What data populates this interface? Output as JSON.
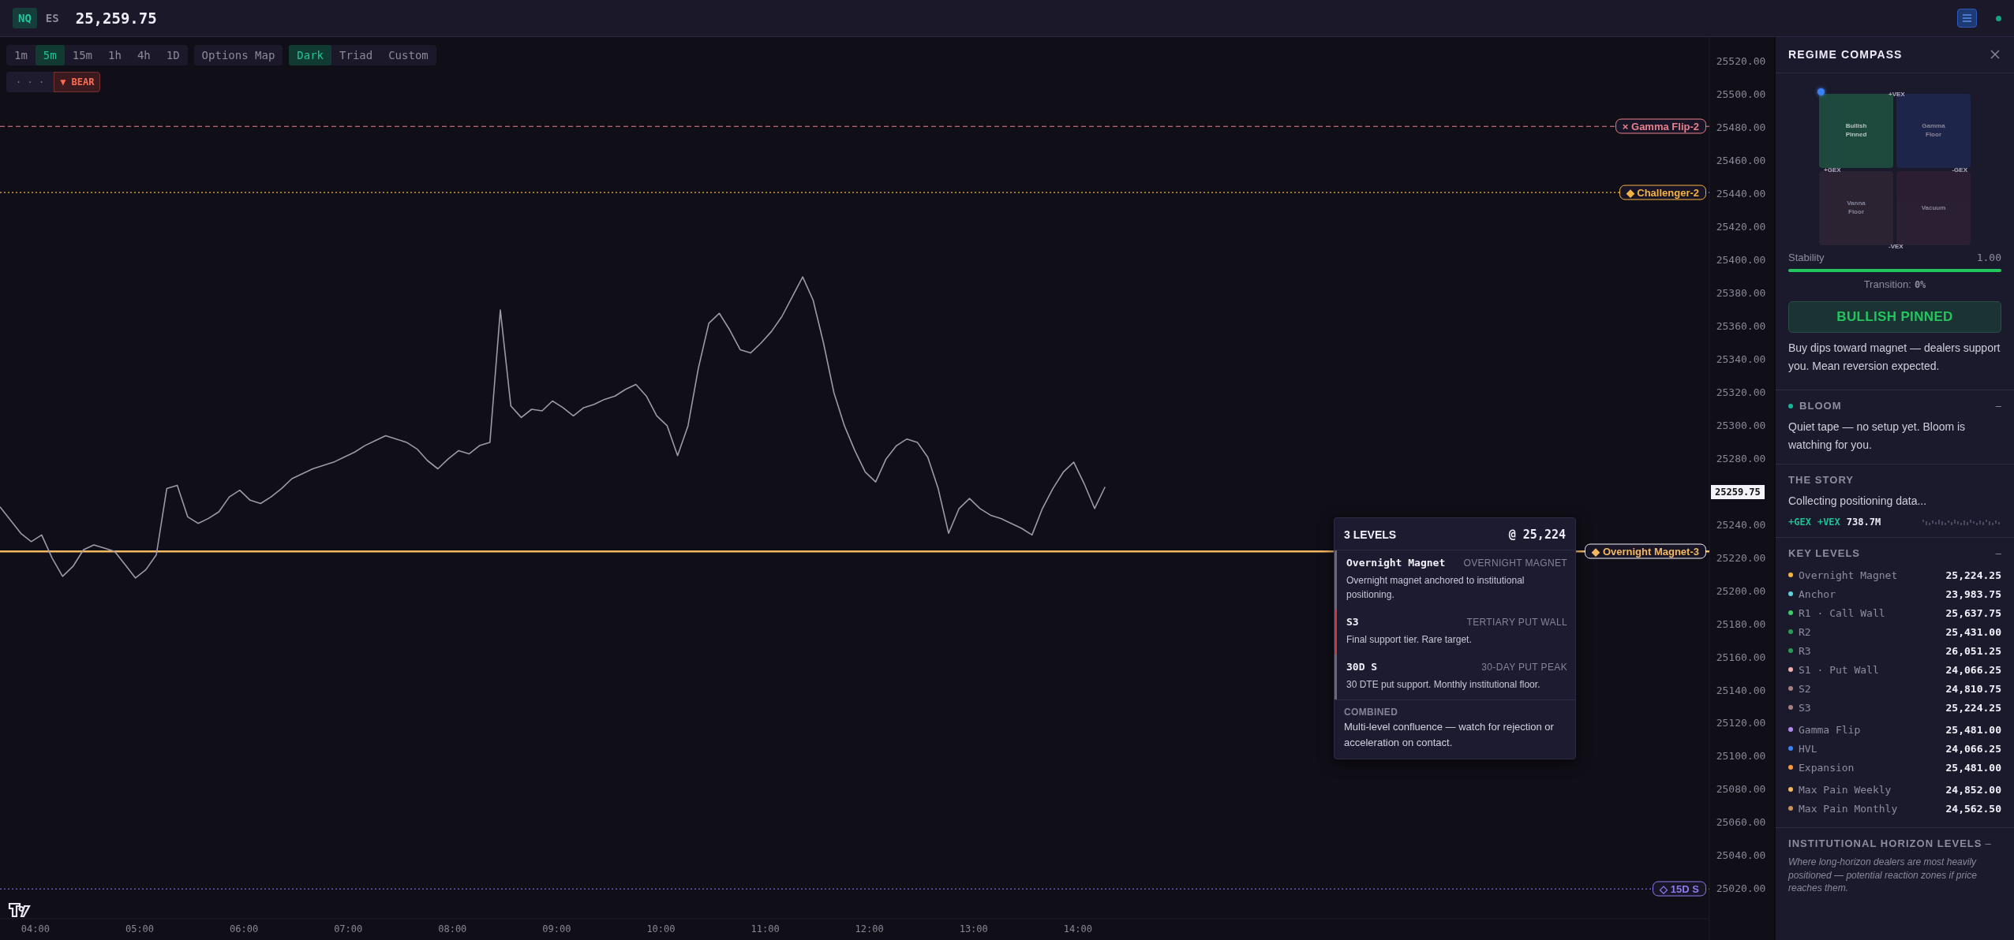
{
  "top_bar": {
    "symbols": [
      {
        "label": "NQ",
        "selected": true
      },
      {
        "label": "ES",
        "selected": false
      }
    ],
    "price": "25,259.75"
  },
  "toolbar": {
    "timeframes": [
      {
        "label": "1m",
        "selected": false
      },
      {
        "label": "5m",
        "selected": true
      },
      {
        "label": "15m",
        "selected": false
      },
      {
        "label": "1h",
        "selected": false
      },
      {
        "label": "4h",
        "selected": false
      },
      {
        "label": "1D",
        "selected": false
      }
    ],
    "options_button": "Options Map",
    "themes": [
      {
        "label": "Dark",
        "selected": true
      },
      {
        "label": "Triad",
        "selected": false
      },
      {
        "label": "Custom",
        "selected": false
      }
    ],
    "more_button": "· · ·",
    "bias": {
      "marker": "▼",
      "label": "BEAR"
    }
  },
  "chart": {
    "price_tag": "25259.75",
    "chart_data": {
      "type": "line",
      "x": [
        3.66,
        3.76,
        3.86,
        3.96,
        4.06,
        4.16,
        4.26,
        4.36,
        4.46,
        4.56,
        4.66,
        4.76,
        4.86,
        4.96,
        5.06,
        5.16,
        5.26,
        5.36,
        5.46,
        5.56,
        5.66,
        5.76,
        5.86,
        5.96,
        6.06,
        6.16,
        6.26,
        6.36,
        6.46,
        6.56,
        6.66,
        6.76,
        6.86,
        6.96,
        7.06,
        7.16,
        7.26,
        7.36,
        7.46,
        7.56,
        7.66,
        7.76,
        7.86,
        7.96,
        8.06,
        8.16,
        8.26,
        8.36,
        8.46,
        8.56,
        8.66,
        8.76,
        8.86,
        8.96,
        9.06,
        9.16,
        9.26,
        9.36,
        9.46,
        9.56,
        9.66,
        9.76,
        9.86,
        9.96,
        10.06,
        10.16,
        10.26,
        10.36,
        10.46,
        10.56,
        10.66,
        10.76,
        10.86,
        10.96,
        11.06,
        11.16,
        11.26,
        11.36,
        11.46,
        11.56,
        11.66,
        11.76,
        11.86,
        11.96,
        12.06,
        12.16,
        12.26,
        12.36,
        12.46,
        12.56,
        12.66,
        12.76,
        12.86,
        12.96,
        13.06,
        13.16,
        13.26,
        13.36,
        13.46,
        13.56,
        13.66,
        13.76,
        13.86,
        13.96,
        14.06,
        14.16,
        14.26
      ],
      "values": [
        25251,
        25243,
        25235,
        25230,
        25234,
        25220,
        25209,
        25215,
        25225,
        25228,
        25226,
        25224,
        25216,
        25208,
        25213,
        25222,
        25262,
        25264,
        25245,
        25241,
        25244,
        25248,
        25257,
        25261,
        25255,
        25253,
        25257,
        25262,
        25268,
        25271,
        25274,
        25276,
        25278,
        25281,
        25284,
        25288,
        25291,
        25294,
        25292,
        25290,
        25286,
        25279,
        25274,
        25280,
        25285,
        25283,
        25288,
        25290,
        25370,
        25312,
        25305,
        25310,
        25309,
        25315,
        25311,
        25306,
        25311,
        25313,
        25316,
        25318,
        25322,
        25325,
        25318,
        25306,
        25300,
        25282,
        25300,
        25335,
        25362,
        25368,
        25358,
        25346,
        25344,
        25350,
        25357,
        25366,
        25378,
        25390,
        25376,
        25350,
        25320,
        25300,
        25285,
        25272,
        25266,
        25280,
        25288,
        25292,
        25290,
        25281,
        25262,
        25235,
        25250,
        25256,
        25250,
        25246,
        25244,
        25241,
        25238,
        25234,
        25250,
        25262,
        25272,
        25278,
        25265,
        25250,
        25263
      ],
      "xlim": [
        3.66,
        20.05
      ],
      "ylim": [
        25002,
        25535
      ],
      "xticks": [
        {
          "value": 4,
          "label": "04:00"
        },
        {
          "value": 5,
          "label": "05:00"
        },
        {
          "value": 6,
          "label": "06:00"
        },
        {
          "value": 7,
          "label": "07:00"
        },
        {
          "value": 8,
          "label": "08:00"
        },
        {
          "value": 9,
          "label": "09:00"
        },
        {
          "value": 10,
          "label": "10:00"
        },
        {
          "value": 11,
          "label": "11:00"
        },
        {
          "value": 12,
          "label": "12:00"
        },
        {
          "value": 13,
          "label": "13:00"
        },
        {
          "value": 14,
          "label": "14:00"
        }
      ],
      "yticks": [
        {
          "value": 25520,
          "label": "25520.00"
        },
        {
          "value": 25500,
          "label": "25500.00"
        },
        {
          "value": 25480,
          "label": "25480.00"
        },
        {
          "value": 25460,
          "label": "25460.00"
        },
        {
          "value": 25440,
          "label": "25440.00"
        },
        {
          "value": 25420,
          "label": "25420.00"
        },
        {
          "value": 25400,
          "label": "25400.00"
        },
        {
          "value": 25380,
          "label": "25380.00"
        },
        {
          "value": 25360,
          "label": "25360.00"
        },
        {
          "value": 25340,
          "label": "25340.00"
        },
        {
          "value": 25320,
          "label": "25320.00"
        },
        {
          "value": 25300,
          "label": "25300.00"
        },
        {
          "value": 25280,
          "label": "25280.00"
        },
        {
          "value": 25240,
          "label": "25240.00"
        },
        {
          "value": 25220,
          "label": "25220.00"
        },
        {
          "value": 25200,
          "label": "25200.00"
        },
        {
          "value": 25180,
          "label": "25180.00"
        },
        {
          "value": 25160,
          "label": "25160.00"
        },
        {
          "value": 25140,
          "label": "25140.00"
        },
        {
          "value": 25120,
          "label": "25120.00"
        },
        {
          "value": 25100,
          "label": "25100.00"
        },
        {
          "value": 25080,
          "label": "25080.00"
        },
        {
          "value": 25060,
          "label": "25060.00"
        },
        {
          "value": 25040,
          "label": "25040.00"
        },
        {
          "value": 25020,
          "label": "25020.00"
        }
      ],
      "ref_lines": [
        {
          "axis": "y",
          "value": 25481,
          "label": "× Gamma Flip-2",
          "color": "#e8808c"
        },
        {
          "axis": "y",
          "value": 25441,
          "label": "◆ Challenger-2",
          "color": "#f5b342"
        },
        {
          "axis": "y",
          "value": 25224,
          "label": "◆ Overnight Magnet-3",
          "color": "#f4b860"
        },
        {
          "axis": "y",
          "value": 25020,
          "label": "◇ 15D S",
          "color": "#8d7cf0"
        }
      ]
    }
  },
  "tooltip": {
    "title": "3 LEVELS",
    "price": "@ 25,224",
    "items": [
      {
        "name": "Overnight Magnet",
        "tag": "OVERNIGHT MAGNET",
        "description": "Overnight magnet anchored to institutional positioning.",
        "color": "#6b6878"
      },
      {
        "name": "S3",
        "tag": "TERTIARY PUT WALL",
        "description": "Final support tier. Rare target.",
        "color": "#c43c3c"
      },
      {
        "name": "30D S",
        "tag": "30-DAY PUT PEAK",
        "description": "30 DTE put support. Monthly institutional floor.",
        "color": "#6b6878"
      }
    ],
    "combined": {
      "label": "COMBINED",
      "text": "Multi-level confluence — watch for rejection or acceleration on contact."
    }
  },
  "panel": {
    "title": "REGIME COMPASS",
    "compass": {
      "quadrants": [
        {
          "label": "Bullish Pinned",
          "color": "#1e4a3e",
          "selected": true
        },
        {
          "label": "Gamma Floor",
          "color": "#1f2750",
          "selected": false
        },
        {
          "label": "Vanna Floor",
          "color": "#2e2533",
          "selected": false
        },
        {
          "label": "Vacuum",
          "color": "#2e2035",
          "selected": false
        }
      ],
      "axes": {
        "top": "+VEX",
        "bottom": "-VEX",
        "left": "+GEX",
        "right": "-GEX"
      }
    },
    "stability": {
      "label": "Stability",
      "reading": "1.00",
      "level": 1
    },
    "transition": {
      "label": "Transition:",
      "value": "0%"
    },
    "regime": "BULLISH PINNED",
    "regime_text": "Buy dips toward magnet — dealers support you. Mean reversion expected.",
    "bloom": {
      "title": "BLOOM",
      "collapse": "–",
      "text": "Quiet tape — no setup yet. Bloom is watching for you."
    },
    "story": {
      "title": "THE STORY",
      "text": "Collecting positioning data...",
      "tags": [
        {
          "label": "+GEX",
          "kind": "tag"
        },
        {
          "label": "+VEX",
          "kind": "tag"
        },
        {
          "label": "738.7M",
          "kind": "value"
        }
      ]
    },
    "key_levels": {
      "title": "KEY LEVELS",
      "collapse": "–",
      "groups": [
        [
          {
            "name": "Overnight Magnet",
            "value": "25,224.25",
            "color": "#f5b342"
          },
          {
            "name": "Anchor",
            "value": "23,983.75",
            "color": "#5fd3d8"
          },
          {
            "name": "R1 · Call Wall",
            "value": "25,637.75",
            "color": "#3ecb68"
          },
          {
            "name": "R2",
            "value": "25,431.00",
            "color": "#2f9a55"
          },
          {
            "name": "R3",
            "value": "26,051.25",
            "color": "#2f9a55"
          },
          {
            "name": "S1 · Put Wall",
            "value": "24,066.25",
            "color": "#f2b0b0"
          },
          {
            "name": "S2",
            "value": "24,810.75",
            "color": "#a88080"
          },
          {
            "name": "S3",
            "value": "25,224.25",
            "color": "#a88080"
          }
        ],
        [
          {
            "name": "Gamma Flip",
            "value": "25,481.00",
            "color": "#b48cf0"
          },
          {
            "name": "HVL",
            "value": "24,066.25",
            "color": "#3b82f6"
          },
          {
            "name": "Expansion",
            "value": "25,481.00",
            "color": "#f59a42"
          }
        ],
        [
          {
            "name": "Max Pain Weekly",
            "value": "24,852.00",
            "color": "#f5b860"
          },
          {
            "name": "Max Pain Monthly",
            "value": "24,562.50",
            "color": "#c8935a"
          }
        ]
      ]
    },
    "horizon": {
      "title": "INSTITUTIONAL HORIZON LEVELS",
      "collapse": "–",
      "text": "Where long-horizon dealers are most heavily positioned — potential reaction zones if price reaches them."
    }
  }
}
